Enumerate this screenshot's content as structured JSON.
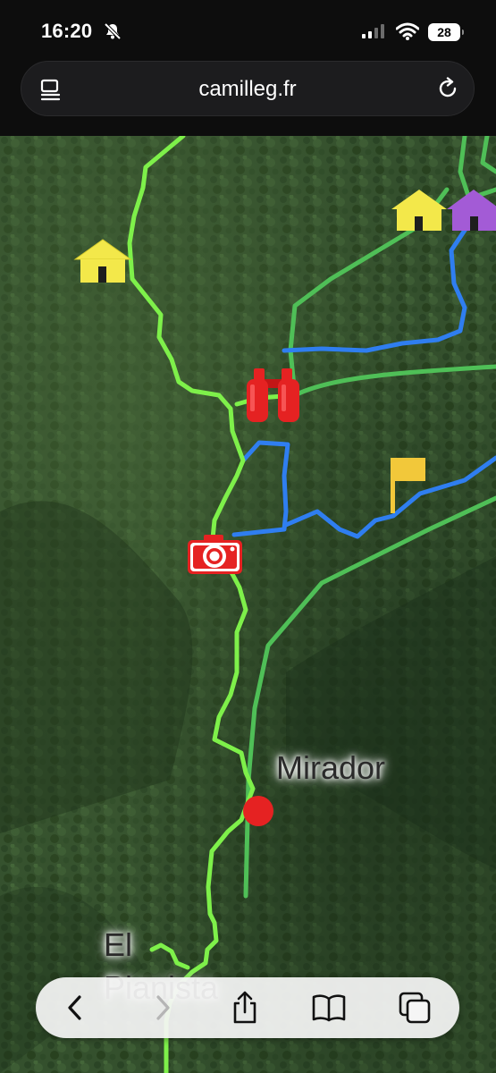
{
  "status_bar": {
    "time": "16:20",
    "battery": "28",
    "icons": [
      "bell-slash-icon",
      "cellular-signal-icon",
      "wifi-icon",
      "battery-icon"
    ]
  },
  "address_bar": {
    "url": "camilleg.fr",
    "icons": [
      "reader-mode-icon",
      "reload-icon"
    ]
  },
  "map": {
    "labels": {
      "mirador": "Mirador",
      "el": "El",
      "pianista": "Pianista"
    },
    "markers": [
      "house-yellow-icon",
      "house-yellow-icon",
      "house-purple-icon",
      "binoculars-icon",
      "camera-icon",
      "flag-icon",
      "mirador-point"
    ],
    "colors": {
      "terrain": "#2f4a2a",
      "trail_light_green": "#7ef04a",
      "trail_dark_green": "#4fbf57",
      "trail_blue": "#2f7ef0",
      "marker_red": "#e52222",
      "house_yellow": "#f3e84a",
      "house_purple": "#a35bd6",
      "flag_yellow": "#f2c83a"
    }
  },
  "toolbar": {
    "buttons": [
      "back",
      "forward",
      "share",
      "bookmarks",
      "tabs"
    ]
  }
}
